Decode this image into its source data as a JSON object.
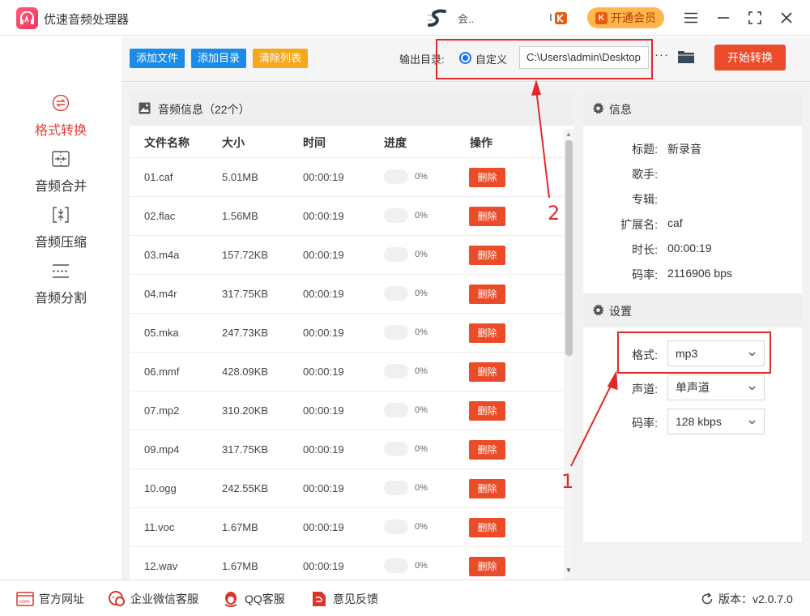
{
  "app": {
    "title": "优速音频处理器",
    "user_name": "会.."
  },
  "header": {
    "vip_label": "开通会员"
  },
  "sidebar": {
    "items": [
      {
        "label": "格式转换",
        "icon": "format-convert-icon",
        "active": true
      },
      {
        "label": "音频合并",
        "icon": "audio-merge-icon"
      },
      {
        "label": "音频压缩",
        "icon": "audio-compress-icon"
      },
      {
        "label": "音频分割",
        "icon": "audio-split-icon"
      }
    ]
  },
  "toolbar": {
    "add_file": "添加文件",
    "add_dir": "添加目录",
    "clear_list": "清除列表",
    "output_label": "输出目录:",
    "radio_label": "自定义",
    "output_path": "C:\\Users\\admin\\Desktop",
    "more": "···",
    "start": "开始转换"
  },
  "file_list": {
    "title": "音频信息（22个）",
    "columns": [
      "文件名称",
      "大小",
      "时间",
      "进度",
      "操作"
    ],
    "rows": [
      {
        "name": "01.caf",
        "size": "5.01MB",
        "time": "00:00:19",
        "progress": "0%",
        "action": "删除"
      },
      {
        "name": "02.flac",
        "size": "1.56MB",
        "time": "00:00:19",
        "progress": "0%",
        "action": "删除"
      },
      {
        "name": "03.m4a",
        "size": "157.72KB",
        "time": "00:00:19",
        "progress": "0%",
        "action": "删除"
      },
      {
        "name": "04.m4r",
        "size": "317.75KB",
        "time": "00:00:19",
        "progress": "0%",
        "action": "删除"
      },
      {
        "name": "05.mka",
        "size": "247.73KB",
        "time": "00:00:19",
        "progress": "0%",
        "action": "删除"
      },
      {
        "name": "06.mmf",
        "size": "428.09KB",
        "time": "00:00:19",
        "progress": "0%",
        "action": "删除"
      },
      {
        "name": "07.mp2",
        "size": "310.20KB",
        "time": "00:00:19",
        "progress": "0%",
        "action": "删除"
      },
      {
        "name": "09.mp4",
        "size": "317.75KB",
        "time": "00:00:19",
        "progress": "0%",
        "action": "删除"
      },
      {
        "name": "10.ogg",
        "size": "242.55KB",
        "time": "00:00:19",
        "progress": "0%",
        "action": "删除"
      },
      {
        "name": "11.voc",
        "size": "1.67MB",
        "time": "00:00:19",
        "progress": "0%",
        "action": "删除"
      },
      {
        "name": "12.wav",
        "size": "1.67MB",
        "time": "00:00:19",
        "progress": "0%",
        "action": "删除"
      }
    ]
  },
  "info": {
    "title": "信息",
    "fields": [
      {
        "k": "标题:",
        "v": "新录音"
      },
      {
        "k": "歌手:",
        "v": ""
      },
      {
        "k": "专辑:",
        "v": ""
      },
      {
        "k": "扩展名:",
        "v": "caf"
      },
      {
        "k": "时长:",
        "v": "00:00:19"
      },
      {
        "k": "码率:",
        "v": "2116906 bps"
      }
    ]
  },
  "settings": {
    "title": "设置",
    "format_label": "格式:",
    "format_value": "mp3",
    "channel_label": "声道:",
    "channel_value": "单声道",
    "bitrate_label": "码率:",
    "bitrate_value": "128 kbps"
  },
  "annotations": {
    "one": "1",
    "two": "2"
  },
  "footer": {
    "website": "官方网址",
    "wechat": "企业微信客服",
    "qq": "QQ客服",
    "feedback": "意见反馈",
    "version": "版本：v2.0.7.0"
  },
  "colors": {
    "accent_red": "#ea4b28",
    "blue_btn": "#1a8be8",
    "orange_btn": "#f4a81c",
    "active_text": "#e0413a"
  }
}
